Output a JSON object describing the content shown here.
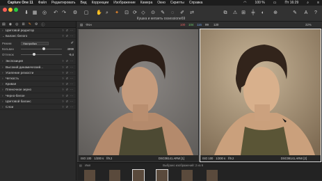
{
  "menubar": {
    "apple": "",
    "app": "Capture One 11",
    "items": [
      "Файл",
      "Редактировать",
      "Вид",
      "Коррекции",
      "Изображение",
      "Камера",
      "Окно",
      "Скрипты",
      "Справка"
    ],
    "status": "100 %",
    "clock": "Пт 16:29"
  },
  "window": {
    "title": "Кушка и кепзеть ossessione69"
  },
  "left_panel": {
    "tabs": [
      "▤",
      "◉",
      "◎",
      "⊞",
      "✎",
      "⚙",
      "ⓘ"
    ],
    "sections_top": [
      {
        "label": "Цветовой редактор",
        "open": false
      },
      {
        "label": "Баланс белого",
        "open": true
      }
    ],
    "wb": {
      "mode_label": "Режим",
      "mode_value": "Настройка",
      "kelvin_label": "Кельвин",
      "kelvin_value": "4999",
      "tint_label": "Оттенок",
      "tint_value": "-9,4",
      "kelvin_pos": 0.55,
      "tint_pos": 0.3
    },
    "sections": [
      {
        "label": "Экспозиция"
      },
      {
        "label": "Высокий динамический..."
      },
      {
        "label": "Усиление резкости"
      },
      {
        "label": "Четкость"
      },
      {
        "label": "Кривая"
      },
      {
        "label": "Пленочное зерно"
      },
      {
        "label": "Черно-белое"
      },
      {
        "label": "Цветовой баланс"
      },
      {
        "label": "Слои"
      }
    ]
  },
  "viewer": {
    "left_label": "Фон",
    "counter_a": "100",
    "counter_b": "104",
    "counter_c": "116",
    "counter_d": "99",
    "counter_e": "120",
    "zoom": "32%",
    "images": [
      {
        "iso": "ISO 100",
        "shutter": "1/200 s",
        "aperture": "f/9.2",
        "file": "DSC08141.ARW [1]"
      },
      {
        "iso": "ISO 100",
        "shutter": "1/200 s",
        "aperture": "f/9.2",
        "file": "DSC08141.ARW [2]"
      }
    ]
  },
  "browser": {
    "sort_label": "Имя",
    "status": "Выбрано изображений: 2 из 6"
  },
  "colors": {
    "accent": "#f0892a",
    "bg": "#2c2c2c"
  }
}
